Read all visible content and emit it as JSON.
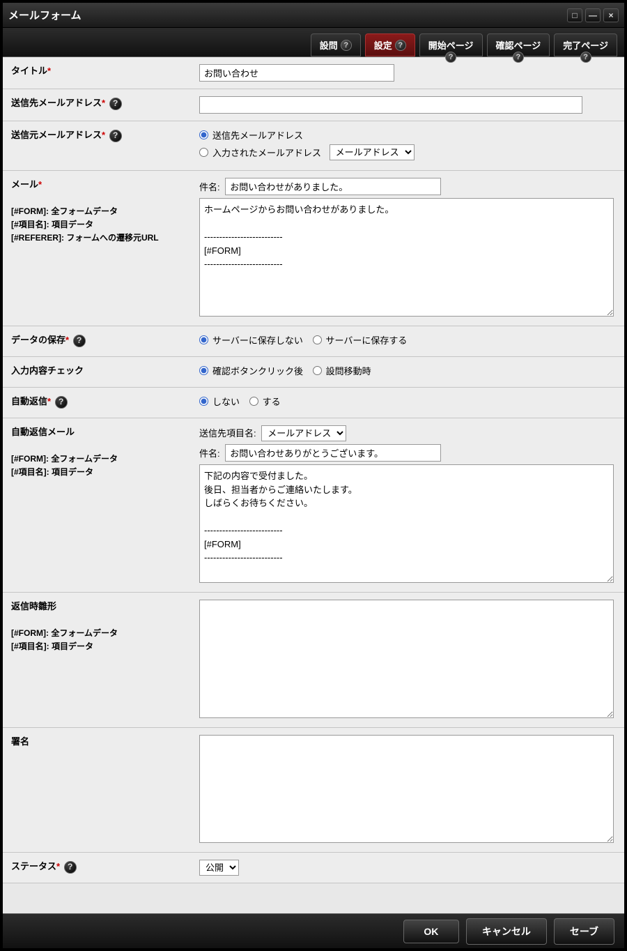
{
  "window": {
    "title": "メールフォーム"
  },
  "tabs": {
    "questions": "設問",
    "settings": "設定",
    "start": "開始ページ",
    "confirm": "確認ページ",
    "done": "完了ページ"
  },
  "fields": {
    "title": {
      "label": "タイトル",
      "value": "お問い合わせ"
    },
    "recipient": {
      "label": "送信先メールアドレス",
      "value": ""
    },
    "sender": {
      "label": "送信元メールアドレス",
      "opt_recipient": "送信先メールアドレス",
      "opt_input": "入力されたメールアドレス",
      "select_value": "メールアドレス"
    },
    "mail": {
      "label": "メール",
      "hint1": "[#FORM]: 全フォームデータ",
      "hint2": "[#項目名]: 項目データ",
      "hint3": "[#REFERER]: フォームへの遷移元URL",
      "subject_label": "件名:",
      "subject_value": "お問い合わせがありました。",
      "body": "ホームページからお問い合わせがありました。\n\n--------------------------\n[#FORM]\n--------------------------"
    },
    "save": {
      "label": "データの保存",
      "opt_no": "サーバーに保存しない",
      "opt_yes": "サーバーに保存する"
    },
    "check": {
      "label": "入力内容チェック",
      "opt_click": "確認ボタンクリック後",
      "opt_move": "設問移動時"
    },
    "autoreply": {
      "label": "自動返信",
      "opt_no": "しない",
      "opt_yes": "する"
    },
    "autoreply_mail": {
      "label": "自動返信メール",
      "hint1": "[#FORM]: 全フォームデータ",
      "hint2": "[#項目名]: 項目データ",
      "dest_label": "送信先項目名:",
      "dest_value": "メールアドレス",
      "subject_label": "件名:",
      "subject_value": "お問い合わせありがとうございます。",
      "body": "下記の内容で受付ました。\n後日、担当者からご連絡いたします。\nしばらくお待ちください。\n\n--------------------------\n[#FORM]\n--------------------------"
    },
    "reply_tpl": {
      "label": "返信時雛形",
      "hint1": "[#FORM]: 全フォームデータ",
      "hint2": "[#項目名]: 項目データ",
      "body": ""
    },
    "signature": {
      "label": "署名",
      "body": ""
    },
    "status": {
      "label": "ステータス",
      "value": "公開"
    }
  },
  "footer": {
    "ok": "OK",
    "cancel": "キャンセル",
    "save": "セーブ"
  }
}
